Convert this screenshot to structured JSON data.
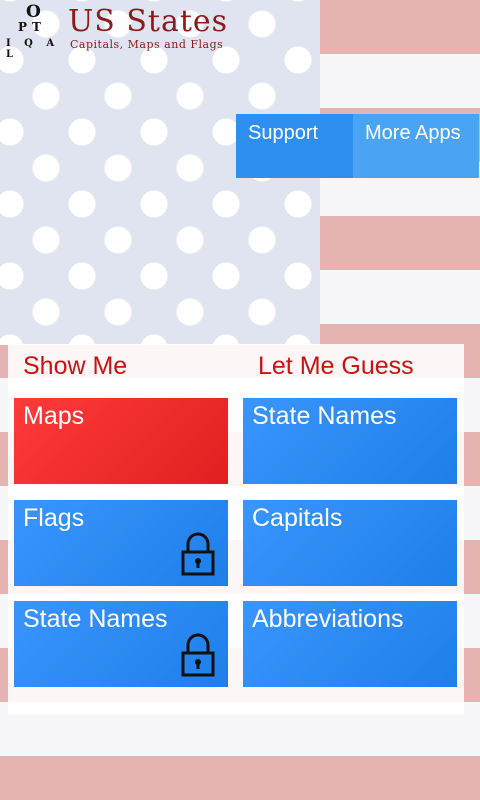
{
  "header": {
    "logo_letters": {
      "o": "O",
      "p": "P",
      "t": "T",
      "bottom": "I Q A L",
      "q": "Q"
    },
    "title": "US States",
    "subtitle": "Capitals, Maps and Flags"
  },
  "top_buttons": {
    "support": "Support",
    "more_apps": "More Apps"
  },
  "sections": {
    "show_me": "Show Me",
    "let_me_guess": "Let Me Guess"
  },
  "tiles": {
    "show_me": [
      {
        "label": "Maps",
        "locked": false,
        "color": "#ff3333"
      },
      {
        "label": "Flags",
        "locked": true,
        "color": "#2f8ff0"
      },
      {
        "label": "State Names",
        "locked": true,
        "color": "#2f8ff0"
      }
    ],
    "let_me_guess": [
      {
        "label": "State Names",
        "locked": false,
        "color": "#2f8ff0"
      },
      {
        "label": "Capitals",
        "locked": false,
        "color": "#2f8ff0"
      },
      {
        "label": "Abbreviations",
        "locked": false,
        "color": "#2f8ff0"
      }
    ]
  },
  "colors": {
    "accent_red": "#cc1111",
    "tile_blue": "#2f8ff0",
    "tile_red": "#ff3333",
    "title_maroon": "#8b1a1a"
  },
  "icons": [
    "lock-icon"
  ]
}
